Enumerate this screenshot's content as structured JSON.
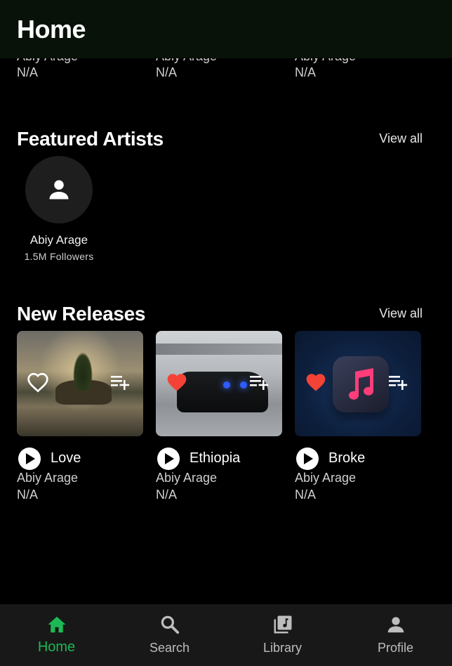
{
  "header": {
    "title": "Home"
  },
  "partial_row": [
    {
      "artist": "Abiy Arage",
      "duration": "N/A"
    },
    {
      "artist": "Abiy Arage",
      "duration": "N/A"
    },
    {
      "artist": "Abiy Arage",
      "duration": "N/A"
    }
  ],
  "featured_artists": {
    "title": "Featured Artists",
    "view_all": "View all",
    "items": [
      {
        "name": "Abiy Arage",
        "followers": "1.5M Followers",
        "icon": "person-icon"
      }
    ]
  },
  "new_releases": {
    "title": "New Releases",
    "view_all": "View all",
    "items": [
      {
        "title": "Love",
        "artist": "Abiy Arage",
        "duration": "N/A",
        "liked": false
      },
      {
        "title": "Ethiopia",
        "artist": "Abiy Arage",
        "duration": "N/A",
        "liked": true
      },
      {
        "title": "Broke",
        "artist": "Abiy Arage",
        "duration": "N/A",
        "liked": true
      }
    ]
  },
  "bottom_nav": {
    "items": [
      {
        "label": "Home",
        "icon": "home-icon",
        "active": true
      },
      {
        "label": "Search",
        "icon": "search-icon",
        "active": false
      },
      {
        "label": "Library",
        "icon": "library-icon",
        "active": false
      },
      {
        "label": "Profile",
        "icon": "profile-icon",
        "active": false
      }
    ]
  },
  "colors": {
    "accent": "#1DB954",
    "like": "#F44336",
    "background": "#000000",
    "header": "#081208",
    "nav": "#181818"
  }
}
